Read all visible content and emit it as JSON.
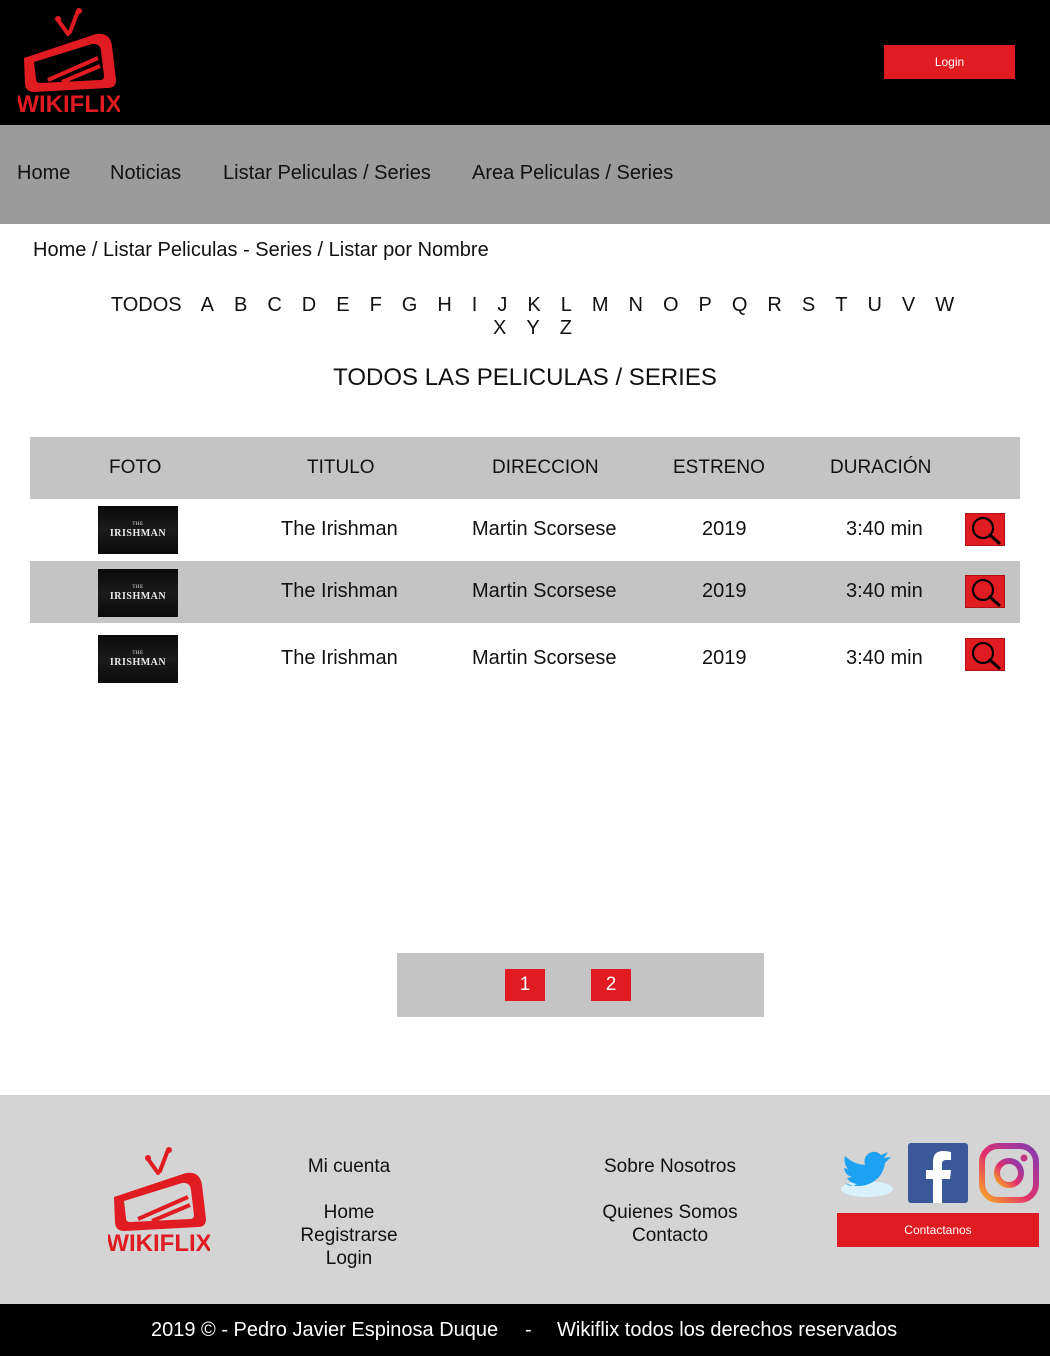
{
  "header": {
    "logo_text": "WIKIFLIX",
    "login_label": "Login"
  },
  "nav": {
    "items": [
      {
        "label": "Home"
      },
      {
        "label": "Noticias"
      },
      {
        "label": "Listar Peliculas / Series"
      },
      {
        "label": "Area Peliculas / Series"
      }
    ]
  },
  "breadcrumb": {
    "text": "Home / Listar Peliculas - Series / Listar por Nombre"
  },
  "letters": {
    "row1": [
      "TODOS",
      "A",
      "B",
      "C",
      "D",
      "E",
      "F",
      "G",
      "H",
      "I",
      "J",
      "K",
      "L",
      "M",
      "N",
      "O",
      "P",
      "Q",
      "R",
      "S",
      "T",
      "U",
      "V",
      "W"
    ],
    "row2": [
      "X",
      "Y",
      "Z"
    ]
  },
  "section_title": "TODOS LAS PELICULAS / SERIES",
  "table": {
    "headers": {
      "foto": "FOTO",
      "titulo": "TITULO",
      "direccion": "DIRECCION",
      "estreno": "ESTRENO",
      "duracion": "DURACIÓN"
    },
    "rows": [
      {
        "poster_small": "THE",
        "poster_title": "IRISHMAN",
        "titulo": "The Irishman",
        "direccion": "Martin Scorsese",
        "estreno": "2019",
        "duracion": "3:40 min"
      },
      {
        "poster_small": "THE",
        "poster_title": "IRISHMAN",
        "titulo": "The Irishman",
        "direccion": "Martin Scorsese",
        "estreno": "2019",
        "duracion": "3:40 min"
      },
      {
        "poster_small": "THE",
        "poster_title": "IRISHMAN",
        "titulo": "The Irishman",
        "direccion": "Martin Scorsese",
        "estreno": "2019",
        "duracion": "3:40 min"
      }
    ],
    "view_icon": "search-icon"
  },
  "pagination": {
    "pages": [
      "1",
      "2"
    ]
  },
  "footer": {
    "logo_text": "WIKIFLIX",
    "cuenta": {
      "heading": "Mi cuenta",
      "links": [
        "Home",
        "Registrarse",
        "Login"
      ]
    },
    "sobre": {
      "heading": "Sobre Nosotros",
      "links": [
        "Quienes Somos",
        "Contacto"
      ]
    },
    "social_icons": [
      "twitter-icon",
      "facebook-icon",
      "instagram-icon"
    ],
    "contact_label": "Contactanos"
  },
  "copyright": {
    "left": "2019 © - Pedro Javier Espinosa Duque",
    "sep": "-",
    "right": "Wikiflix todos los derechos reservados"
  },
  "colors": {
    "accent": "#e11b22",
    "header_bg": "#000000",
    "nav_bg": "#9b9b9b",
    "table_header_bg": "#c4c4c4",
    "footer_bg": "#d4d4d4"
  }
}
